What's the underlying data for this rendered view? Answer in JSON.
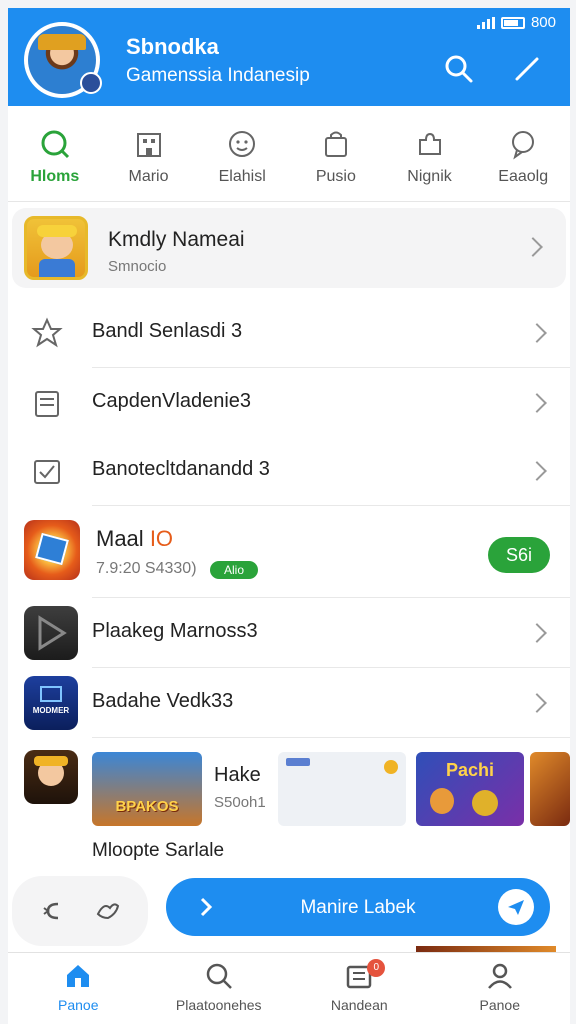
{
  "status": {
    "time": "800"
  },
  "header": {
    "title": "Sbnodka",
    "subtitle": "Gamenssia Indanesip"
  },
  "tabs": [
    {
      "label": "Hloms",
      "icon": "search-icon",
      "active": true
    },
    {
      "label": "Mario",
      "icon": "building-icon",
      "active": false
    },
    {
      "label": "Elahisl",
      "icon": "smiley-icon",
      "active": false
    },
    {
      "label": "Pusio",
      "icon": "bag-icon",
      "active": false
    },
    {
      "label": "Nignik",
      "icon": "puzzle-icon",
      "active": false
    },
    {
      "label": "Eaaolg",
      "icon": "chat-icon",
      "active": false
    }
  ],
  "profile": {
    "name": "Kmdly Nameai",
    "sub": "Smnocio"
  },
  "rows": [
    {
      "label": "Bandl Senlasdi 3",
      "icon": "star-icon"
    },
    {
      "label": "CapdenVladenie3",
      "icon": "notebook-icon"
    },
    {
      "label": "Banotecltdanandd 3",
      "icon": "checkbox-icon"
    }
  ],
  "featured": {
    "title_a": "Maal",
    "title_b": "IO",
    "meta": "7.9:20 S4330)",
    "tag": "Alio",
    "button": "S6i"
  },
  "rows2": [
    {
      "label": "Plaakeg Marnoss3"
    },
    {
      "label": "Badahe Vedk33"
    }
  ],
  "media": {
    "banner_title": "Hake",
    "banner_sub": "S50oh1",
    "thumb_text": "BPAKOS",
    "thumb_art": "Pachi",
    "icon_text": "MODMER",
    "caption": "Mloopte Sarlale"
  },
  "action": {
    "label": "Manire Labek"
  },
  "bottom_nav": [
    {
      "label": "Panoe",
      "icon": "home-icon",
      "active": true
    },
    {
      "label": "Plaatoonehes",
      "icon": "search-icon",
      "active": false
    },
    {
      "label": "Nandean",
      "icon": "inbox-icon",
      "active": false,
      "badge": "0"
    },
    {
      "label": "Panoe",
      "icon": "user-icon",
      "active": false
    }
  ],
  "colors": {
    "brand": "#1e8df0",
    "accent": "#2aa33a",
    "notify": "#e5533d"
  }
}
